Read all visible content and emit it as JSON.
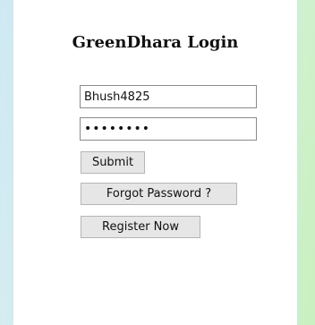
{
  "login": {
    "title": "GreenDhara Login",
    "username_value": "Bhush4825",
    "password_value": "••••••••",
    "submit_label": "Submit",
    "forgot_label": "Forgot Password ?",
    "register_label": "Register Now"
  },
  "colors": {
    "background_left": "#cfe9f4",
    "background_right": "#c9f0c0",
    "button_bg": "#e6e6e6"
  }
}
